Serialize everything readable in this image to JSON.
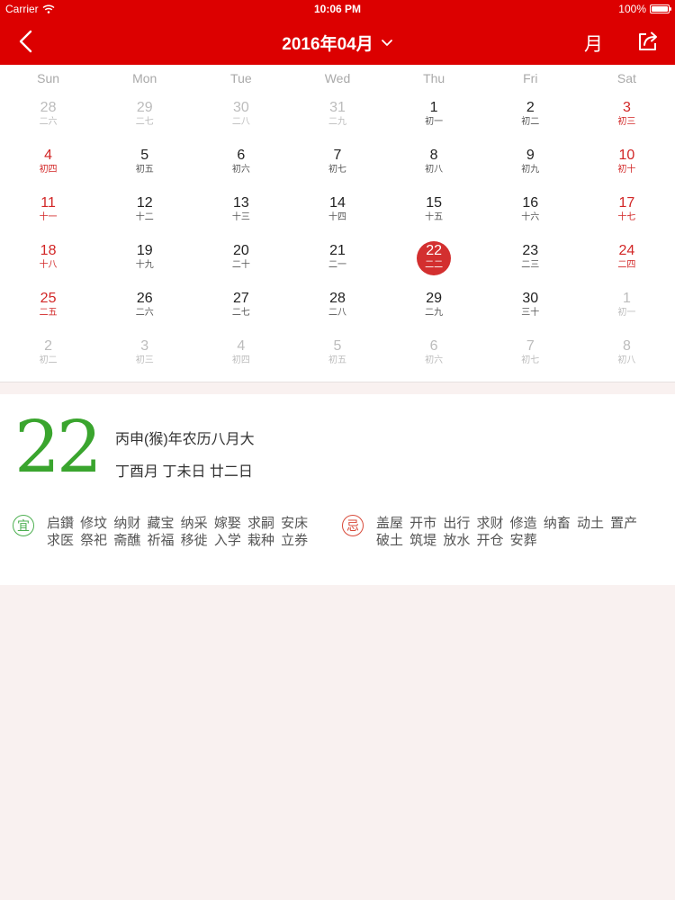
{
  "status_bar": {
    "carrier": "Carrier",
    "time": "10:06 PM",
    "battery": "100%",
    "battery_level": 1.0
  },
  "nav": {
    "title": "2016年04月",
    "month_button": "月",
    "back_icon": "chevron-left-icon",
    "share_icon": "share-icon",
    "dropdown_icon": "chevron-down-icon"
  },
  "colors": {
    "brand_red": "#dc0000",
    "weekend_red": "#d22626",
    "selected_circle": "#d32f2f",
    "yi_green": "#4caf50",
    "ji_red": "#d84a3a",
    "day_green": "#3aa52e"
  },
  "calendar": {
    "weekdays": [
      "Sun",
      "Mon",
      "Tue",
      "Wed",
      "Thu",
      "Fri",
      "Sat"
    ],
    "weeks": [
      [
        {
          "day": "28",
          "lunar": "二六",
          "other": true
        },
        {
          "day": "29",
          "lunar": "二七",
          "other": true
        },
        {
          "day": "30",
          "lunar": "二八",
          "other": true
        },
        {
          "day": "31",
          "lunar": "二九",
          "other": true
        },
        {
          "day": "1",
          "lunar": "初一"
        },
        {
          "day": "2",
          "lunar": "初二"
        },
        {
          "day": "3",
          "lunar": "初三"
        }
      ],
      [
        {
          "day": "4",
          "lunar": "初四"
        },
        {
          "day": "5",
          "lunar": "初五"
        },
        {
          "day": "6",
          "lunar": "初六"
        },
        {
          "day": "7",
          "lunar": "初七"
        },
        {
          "day": "8",
          "lunar": "初八"
        },
        {
          "day": "9",
          "lunar": "初九"
        },
        {
          "day": "10",
          "lunar": "初十"
        }
      ],
      [
        {
          "day": "11",
          "lunar": "十一"
        },
        {
          "day": "12",
          "lunar": "十二"
        },
        {
          "day": "13",
          "lunar": "十三"
        },
        {
          "day": "14",
          "lunar": "十四"
        },
        {
          "day": "15",
          "lunar": "十五"
        },
        {
          "day": "16",
          "lunar": "十六"
        },
        {
          "day": "17",
          "lunar": "十七"
        }
      ],
      [
        {
          "day": "18",
          "lunar": "十八"
        },
        {
          "day": "19",
          "lunar": "十九"
        },
        {
          "day": "20",
          "lunar": "二十"
        },
        {
          "day": "21",
          "lunar": "二一"
        },
        {
          "day": "22",
          "lunar": "二二",
          "selected": true
        },
        {
          "day": "23",
          "lunar": "二三"
        },
        {
          "day": "24",
          "lunar": "二四"
        }
      ],
      [
        {
          "day": "25",
          "lunar": "二五"
        },
        {
          "day": "26",
          "lunar": "二六"
        },
        {
          "day": "27",
          "lunar": "二七"
        },
        {
          "day": "28",
          "lunar": "二八"
        },
        {
          "day": "29",
          "lunar": "二九"
        },
        {
          "day": "30",
          "lunar": "三十"
        },
        {
          "day": "1",
          "lunar": "初一",
          "other": true
        }
      ],
      [
        {
          "day": "2",
          "lunar": "初二",
          "other": true
        },
        {
          "day": "3",
          "lunar": "初三",
          "other": true
        },
        {
          "day": "4",
          "lunar": "初四",
          "other": true
        },
        {
          "day": "5",
          "lunar": "初五",
          "other": true
        },
        {
          "day": "6",
          "lunar": "初六",
          "other": true
        },
        {
          "day": "7",
          "lunar": "初七",
          "other": true
        },
        {
          "day": "8",
          "lunar": "初八",
          "other": true
        }
      ]
    ]
  },
  "detail": {
    "day": "22",
    "lunar_year": "丙申(猴)年农历八月大",
    "lunar_day": "丁酉月 丁未日 廿二日",
    "yi_label": "宜",
    "yi_text": "启鑽 修坟 纳财 藏宝 纳采 嫁娶 求嗣 安床 求医 祭祀 斋醮 祈福 移徙 入学 栽种 立券",
    "ji_label": "忌",
    "ji_text": "盖屋 开市 出行 求财 修造 纳畜 动土 置产 破土 筑堤 放水 开仓 安葬"
  }
}
